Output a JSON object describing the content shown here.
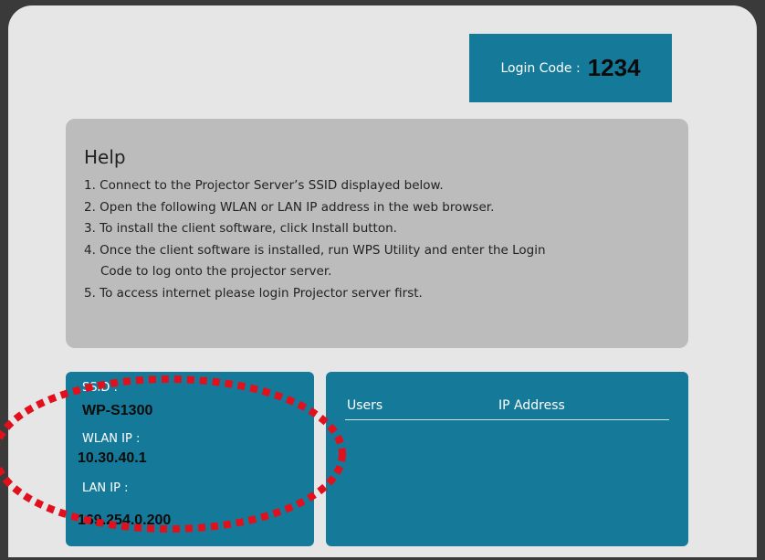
{
  "login": {
    "label": "Login Code :",
    "code": "1234"
  },
  "help": {
    "title": "Help",
    "items": [
      "1. Connect to the Projector Server’s SSID displayed below.",
      "2. Open the following WLAN or LAN IP address in the web browser.",
      "3. To install the client software, click Install button.",
      "4. Once the client software is installed, run WPS Utility and enter the Login",
      "Code to log onto the projector server.",
      "5. To access internet please login Projector server first."
    ]
  },
  "network": {
    "ssid_label": "SSID :",
    "ssid_value": "WP-S1300",
    "wlan_label": "WLAN IP :",
    "wlan_value": "10.30.40.1",
    "lan_label": "LAN IP :",
    "lan_value": "169.254.0.200"
  },
  "users_table": {
    "col_users": "Users",
    "col_ip": "IP Address"
  },
  "colors": {
    "accent": "#157a9a",
    "help_bg": "#bcbcbc",
    "highlight": "#e0101c"
  }
}
